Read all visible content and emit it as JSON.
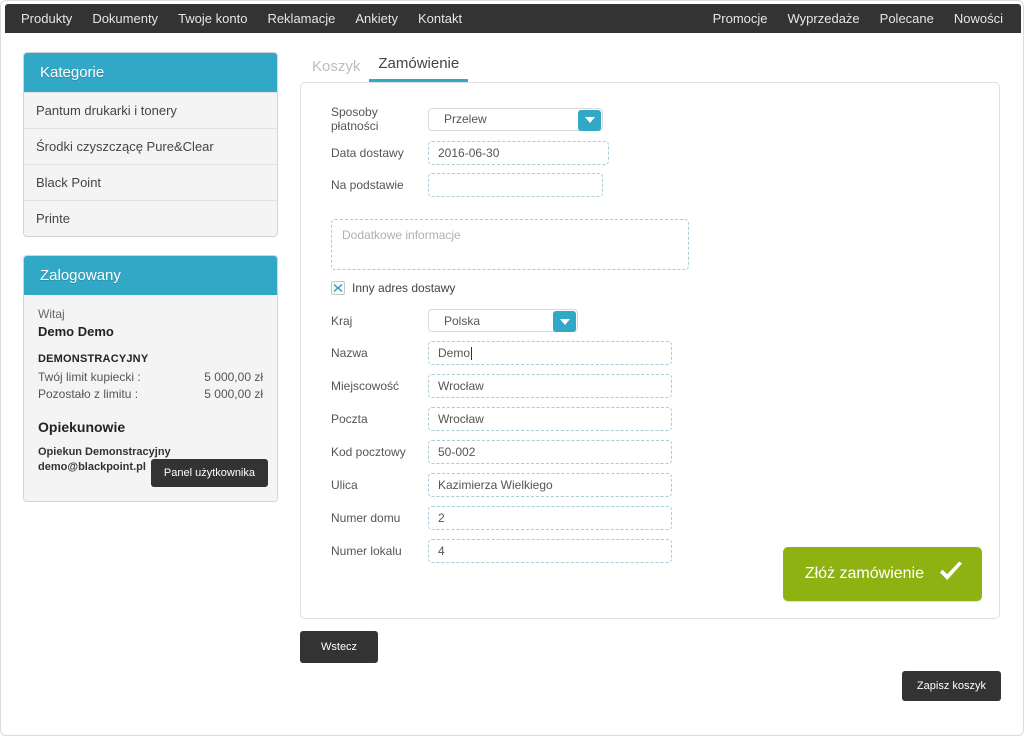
{
  "nav": {
    "left_items": [
      {
        "label": "Produkty"
      },
      {
        "label": "Dokumenty"
      },
      {
        "label": "Twoje konto"
      },
      {
        "label": "Reklamacje"
      },
      {
        "label": "Ankiety"
      },
      {
        "label": "Kontakt"
      }
    ],
    "right_items": [
      {
        "label": "Promocje"
      },
      {
        "label": "Wyprzedaże"
      },
      {
        "label": "Polecane"
      },
      {
        "label": "Nowości"
      }
    ]
  },
  "sidebar": {
    "categories": {
      "title": "Kategorie",
      "items": [
        {
          "label": "Pantum drukarki i tonery"
        },
        {
          "label": "Środki czyszczącę Pure&Clear"
        },
        {
          "label": "Black Point"
        },
        {
          "label": "Printe"
        }
      ]
    },
    "account": {
      "title": "Zalogowany",
      "greeting": "Witaj",
      "user_name": "Demo Demo",
      "account_type": "DEMONSTRACYJNY",
      "limit_label": "Twój limit kupiecki :",
      "limit_value": "5 000,00 zł",
      "remaining_label": "Pozostało z limitu :",
      "remaining_value": "5 000,00 zł",
      "caretakers_title": "Opiekunowie",
      "caretaker_name": "Opiekun Demonstracyjny",
      "caretaker_email": "demo@blackpoint.pl",
      "panel_button": "Panel użytkownika"
    }
  },
  "main": {
    "tabs": [
      {
        "label": "Koszyk",
        "active": false
      },
      {
        "label": "Zamówienie",
        "active": true
      }
    ],
    "form": {
      "payment_label": "Sposoby płatności",
      "payment_value": "Przelew",
      "delivery_date_label": "Data dostawy",
      "delivery_date_value": "2016-06-30",
      "basis_label": "Na podstawie",
      "basis_value": "",
      "notes_placeholder": "Dodatkowe informacje",
      "notes_value": "",
      "other_address_label": "Inny adres dostawy",
      "other_address_checked": true,
      "country_label": "Kraj",
      "country_value": "Polska",
      "name_label": "Nazwa",
      "name_value": "Demo",
      "city_label": "Miejscowość",
      "city_value": "Wrocław",
      "post_office_label": "Poczta",
      "post_office_value": "Wrocław",
      "postcode_label": "Kod pocztowy",
      "postcode_value": "50-002",
      "street_label": "Ulica",
      "street_value": "Kazimierza Wielkiego",
      "house_number_label": "Numer domu",
      "house_number_value": "2",
      "flat_number_label": "Numer lokalu",
      "flat_number_value": "4"
    },
    "submit_button": "Złóż zamówienie",
    "back_button": "Wstecz",
    "save_cart_button": "Zapisz koszyk"
  },
  "icons": {
    "chevron_down": "chevron-down-icon",
    "check": "check-icon",
    "checkbox_x": "checkbox-x-icon"
  },
  "colors": {
    "nav_bg": "#333333",
    "accent_teal": "#32a8c7",
    "submit_green": "#8fb213",
    "dashed_border": "#a9cdd6",
    "page_bg": "#ffffff"
  }
}
